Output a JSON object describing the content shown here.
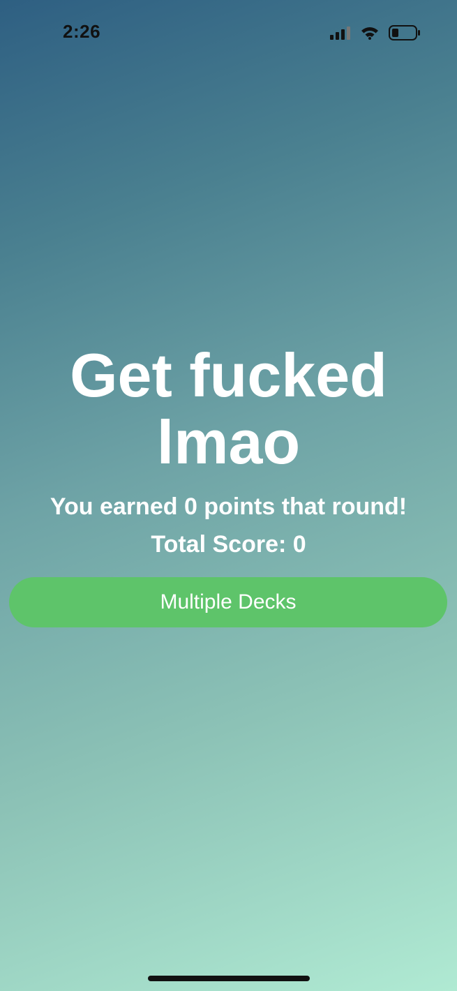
{
  "status_bar": {
    "time": "2:26",
    "icons": [
      "signal-icon",
      "wifi-icon",
      "battery-icon"
    ]
  },
  "result": {
    "headline": "Get fucked lmao",
    "earned_text": "You earned 0 points that round!",
    "total_text": "Total Score: 0"
  },
  "actions": {
    "primary_label": "Multiple Decks"
  },
  "colors": {
    "button": "#5ec46a",
    "gradient_top": "#2e5f82",
    "gradient_bottom": "#b0ead3",
    "text": "#ffffff"
  }
}
